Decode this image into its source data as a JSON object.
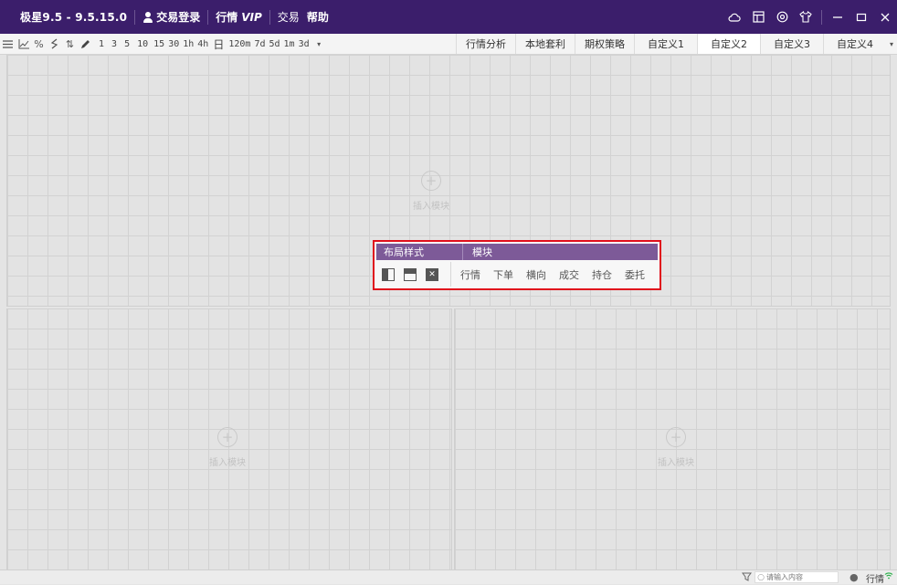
{
  "titlebar": {
    "app_title": "极星9.5 - 9.5.15.0",
    "login_label": "交易登录",
    "market_label": "行情",
    "vip_label": "VIP",
    "trade_label": "交易",
    "help_label": "帮助",
    "right_icons": [
      "cloud-icon",
      "layout-icon",
      "settings-icon",
      "shirt-icon"
    ],
    "window_controls": [
      "minimize-icon",
      "maximize-icon",
      "close-icon"
    ]
  },
  "toolbar": {
    "tool_icons": [
      "list-icon",
      "line-chart-icon",
      "percent-icon",
      "wave-icon",
      "sort-icon",
      "pen-icon"
    ],
    "periods": [
      "1",
      "3",
      "5",
      "10",
      "15",
      "30",
      "1h",
      "4h",
      "日",
      "120m",
      "7d",
      "5d",
      "1m",
      "3d"
    ],
    "tabs": [
      {
        "label": "行情分析",
        "active": false
      },
      {
        "label": "本地套利",
        "active": false
      },
      {
        "label": "期权策略",
        "active": false
      },
      {
        "label": "自定义1",
        "active": false
      },
      {
        "label": "自定义2",
        "active": true
      },
      {
        "label": "自定义3",
        "active": false
      },
      {
        "label": "自定义4",
        "active": false
      }
    ]
  },
  "panes": {
    "top_insert_label": "插入模块",
    "bottom_left_insert_label": "插入模块",
    "bottom_right_insert_label": "插入模块"
  },
  "popup": {
    "layout_header": "布局样式",
    "module_header": "模块",
    "modules": [
      "行情",
      "下单",
      "横向",
      "成交",
      "持仓",
      "委托"
    ],
    "accent_color": "#7d5a98",
    "highlight_border": "#e0101c"
  },
  "statusbar": {
    "search_placeholder": "请输入内容",
    "market_status": "行情"
  },
  "colors": {
    "titlebar_bg": "#3b1e6b",
    "workspace_bg": "#e3e3e3"
  }
}
